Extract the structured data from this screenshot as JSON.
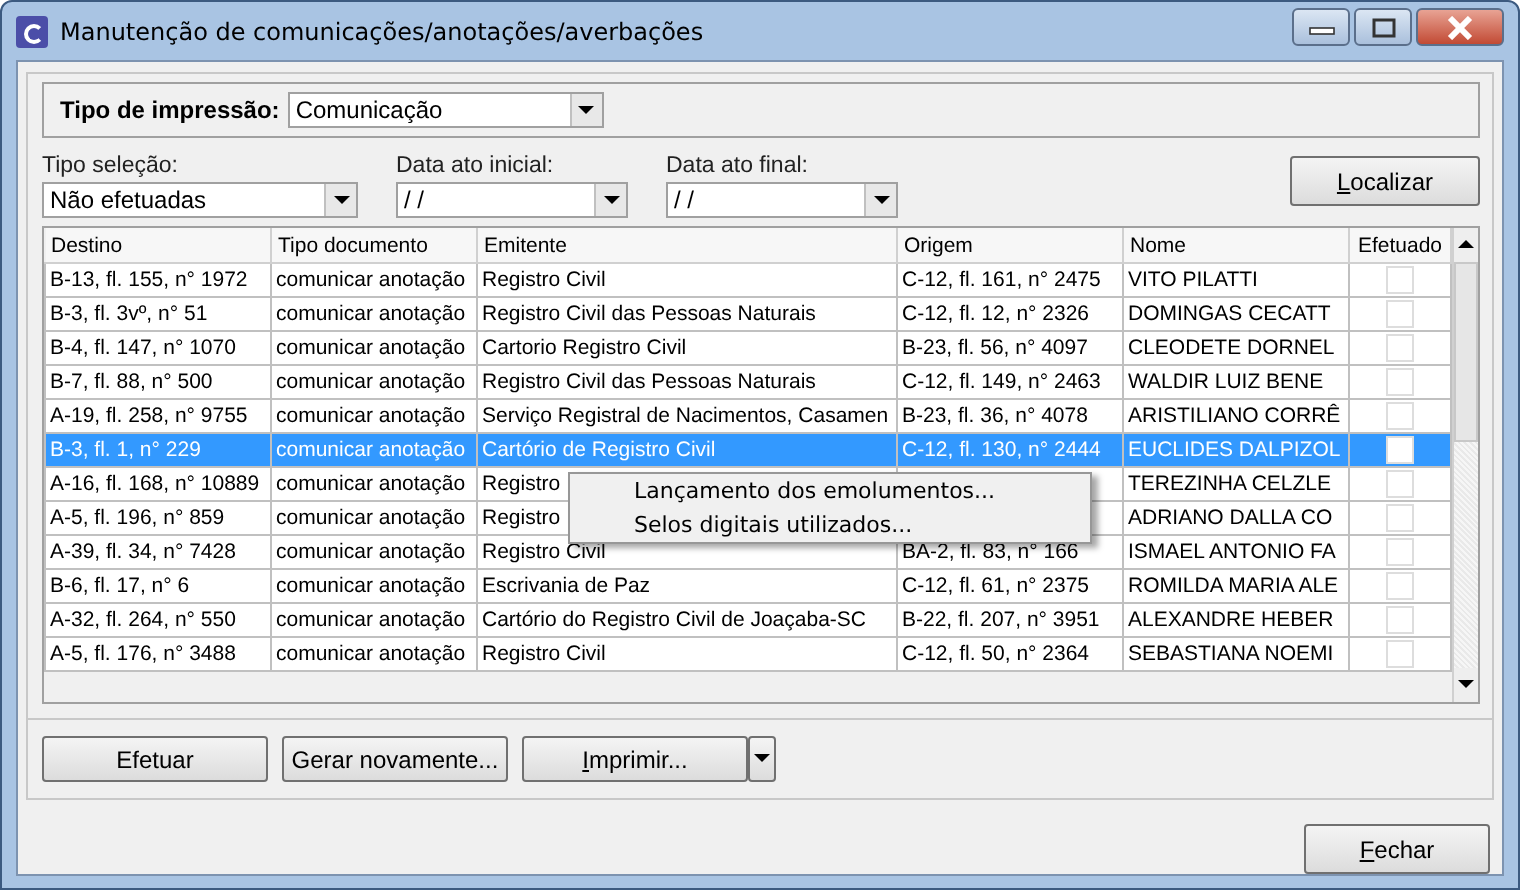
{
  "window": {
    "title": "Manutenção de comunicações/anotações/averbações"
  },
  "print_type": {
    "label": "Tipo de impressão:",
    "value": "Comunicação"
  },
  "filters": [
    {
      "label": "Tipo seleção:",
      "value": "Não efetuadas"
    },
    {
      "label": "Data ato inicial:",
      "value": "/ /"
    },
    {
      "label": "Data ato final:",
      "value": "/ /"
    }
  ],
  "search_button": "Localizar",
  "table": {
    "columns": [
      "Destino",
      "Tipo documento",
      "Emitente",
      "Origem",
      "Nome",
      "Efetuado"
    ],
    "rows": [
      {
        "cells": [
          "B-13, fl. 155, n° 1972",
          "comunicar anotação",
          "Registro Civil",
          "C-12, fl. 161, n° 2475",
          "VITO PILATTI"
        ],
        "efetuado": false,
        "selected": false
      },
      {
        "cells": [
          "B-3, fl. 3vº, n° 51",
          "comunicar anotação",
          "Registro Civil das Pessoas Naturais",
          "C-12, fl. 12, n° 2326",
          "DOMINGAS CECATT"
        ],
        "efetuado": false,
        "selected": false
      },
      {
        "cells": [
          "B-4, fl. 147, n° 1070",
          "comunicar anotação",
          "Cartorio Registro Civil",
          "B-23, fl. 56, n° 4097",
          "CLEODETE DORNEL"
        ],
        "efetuado": false,
        "selected": false
      },
      {
        "cells": [
          "B-7, fl. 88, n° 500",
          "comunicar anotação",
          "Registro Civil das Pessoas Naturais",
          "C-12, fl. 149, n° 2463",
          "WALDIR LUIZ BENE"
        ],
        "efetuado": false,
        "selected": false
      },
      {
        "cells": [
          "A-19, fl. 258, n° 9755",
          "comunicar anotação",
          "Serviço Registral de Nacimentos, Casamen",
          "B-23, fl. 36, n° 4078",
          "ARISTILIANO CORRÊ"
        ],
        "efetuado": false,
        "selected": false
      },
      {
        "cells": [
          "B-3, fl. 1, n° 229",
          "comunicar anotação",
          "Cartório de Registro Civil",
          "C-12, fl. 130, n° 2444",
          "EUCLIDES DALPIZOL"
        ],
        "efetuado": false,
        "selected": true
      },
      {
        "cells": [
          "A-16, fl. 168, n° 10889",
          "comunicar anotação",
          "Registro",
          "",
          "TEREZINHA CELZLE"
        ],
        "efetuado": false,
        "selected": false
      },
      {
        "cells": [
          "A-5, fl. 196, n° 859",
          "comunicar anotação",
          "Registro",
          "",
          "ADRIANO DALLA CO"
        ],
        "efetuado": false,
        "selected": false
      },
      {
        "cells": [
          "A-39, fl. 34, n° 7428",
          "comunicar anotação",
          "Registro Civil",
          "BA-2, fl. 83, n° 166",
          "ISMAEL ANTONIO FA"
        ],
        "efetuado": false,
        "selected": false
      },
      {
        "cells": [
          "B-6, fl. 17, n° 6",
          "comunicar anotação",
          "Escrivania de Paz",
          "C-12, fl. 61, n° 2375",
          "ROMILDA MARIA ALE"
        ],
        "efetuado": false,
        "selected": false
      },
      {
        "cells": [
          "A-32, fl. 264, n° 550",
          "comunicar anotação",
          "Cartório do Registro Civil de Joaçaba-SC",
          "B-22, fl. 207, n° 3951",
          "ALEXANDRE HEBER"
        ],
        "efetuado": false,
        "selected": false
      },
      {
        "cells": [
          "A-5, fl. 176, n° 3488",
          "comunicar anotação",
          "Registro Civil",
          "C-12, fl. 50, n° 2364",
          "SEBASTIANA NOEMI"
        ],
        "efetuado": false,
        "selected": false
      }
    ]
  },
  "context_menu": {
    "items": [
      "Lançamento dos emolumentos...",
      "Selos digitais utilizados..."
    ]
  },
  "action_buttons": [
    "Efetuar",
    "Gerar novamente...",
    "Imprimir..."
  ],
  "close_button": "Fechar"
}
